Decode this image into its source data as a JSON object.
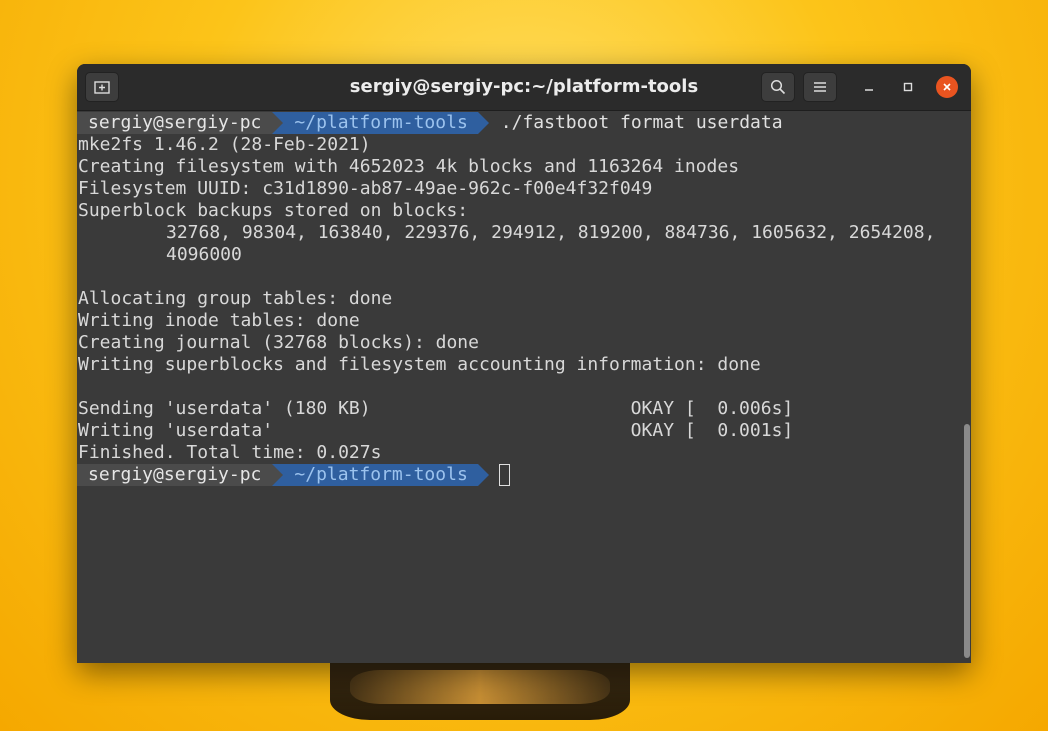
{
  "window": {
    "title": "sergiy@sergiy-pc:~/platform-tools"
  },
  "icons": {
    "new_tab": "new-tab-icon",
    "search": "search-icon",
    "menu": "hamburger-menu-icon",
    "minimize": "minimize-icon",
    "maximize": "maximize-icon",
    "close": "close-icon"
  },
  "colors": {
    "close_button": "#e95420",
    "prompt_path_bg": "#2f5f9f",
    "terminal_bg": "#3a3a3a"
  },
  "prompt": {
    "user": "sergiy@sergiy-pc",
    "path": "~/platform-tools"
  },
  "terminal": {
    "command": "./fastboot format userdata",
    "output": [
      "mke2fs 1.46.2 (28-Feb-2021)",
      "Creating filesystem with 4652023 4k blocks and 1163264 inodes",
      "Filesystem UUID: c31d1890-ab87-49ae-962c-f00e4f32f049",
      "Superblock backups stored on blocks:",
      "32768, 98304, 163840, 229376, 294912, 819200, 884736, 1605632, 2654208,",
      "4096000",
      "",
      "Allocating group tables: done",
      "Writing inode tables: done",
      "Creating journal (32768 blocks): done",
      "Writing superblocks and filesystem accounting information: done",
      "",
      "Sending 'userdata' (180 KB)                        OKAY [  0.006s]",
      "Writing 'userdata'                                 OKAY [  0.001s]",
      "Finished. Total time: 0.027s"
    ]
  }
}
